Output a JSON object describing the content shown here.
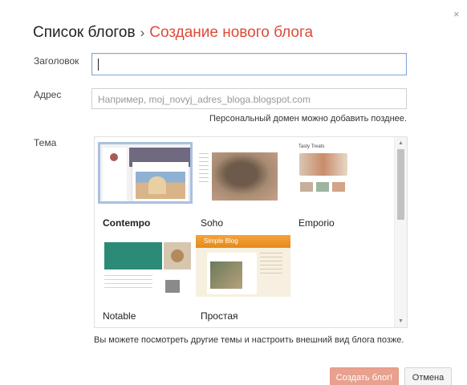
{
  "dialog": {
    "close_glyph": "×",
    "breadcrumb": {
      "parent": "Список блогов",
      "separator": "›",
      "current": "Создание нового блога"
    }
  },
  "form": {
    "title_label": "Заголовок",
    "title_value": "",
    "address_label": "Адрес",
    "address_placeholder": "Например, moj_novyj_adres_bloga.blogspot.com",
    "address_hint": "Персональный домен можно добавить позднее.",
    "theme_label": "Тема"
  },
  "themes": {
    "items": [
      {
        "name": "Contempo",
        "selected": true
      },
      {
        "name": "Soho",
        "selected": false
      },
      {
        "name": "Emporio",
        "selected": false
      },
      {
        "name": "Notable",
        "selected": false
      },
      {
        "name": "Простая",
        "selected": false
      }
    ],
    "previews": {
      "emporio_heading": "Tasty Treats",
      "simple_heading": "Simple Blog"
    },
    "footer_hint": "Вы можете посмотреть другие темы и настроить внешний вид блога позже."
  },
  "actions": {
    "create_label": "Создать блог!",
    "cancel_label": "Отмена"
  },
  "colors": {
    "accent": "#dd4b39",
    "create_button": "#e8a08f",
    "focus_border": "#7ea6d8"
  }
}
